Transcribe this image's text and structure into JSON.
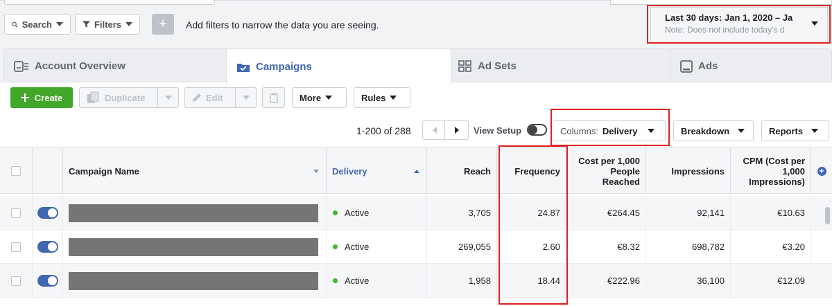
{
  "toolbar": {
    "search_label": "Search",
    "filters_label": "Filters",
    "add_filter_symbol": "+",
    "hint": "Add filters to narrow the data you are seeing."
  },
  "date_range": {
    "label": "Last 30 days: Jan 1, 2020 – Ja",
    "note": "Note: Does not include today's d"
  },
  "tabs": [
    {
      "label": "Account Overview",
      "icon": "account-overview-icon"
    },
    {
      "label": "Campaigns",
      "icon": "folder-check-icon"
    },
    {
      "label": "Ad Sets",
      "icon": "grid-icon"
    },
    {
      "label": "Ads",
      "icon": "ad-icon"
    }
  ],
  "actions": {
    "create_label": "Create",
    "duplicate_label": "Duplicate",
    "edit_label": "Edit",
    "more_label": "More",
    "rules_label": "Rules"
  },
  "pagination": {
    "range": "1-200 of 288",
    "view_setup_label": "View Setup"
  },
  "view_controls": {
    "columns_prefix": "Columns:",
    "columns_value": "Delivery",
    "breakdown_label": "Breakdown",
    "reports_label": "Reports"
  },
  "table": {
    "headers": {
      "campaign_name": "Campaign Name",
      "delivery": "Delivery",
      "reach": "Reach",
      "frequency": "Frequency",
      "cost_per_1000": "Cost per 1,000 People Reached",
      "impressions": "Impressions",
      "cpm": "CPM (Cost per 1,000 Impressions)"
    },
    "rows": [
      {
        "delivery": "Active",
        "reach": "3,705",
        "frequency": "24.87",
        "cost_per_1000": "€264.45",
        "impressions": "92,141",
        "cpm": "€10.63"
      },
      {
        "delivery": "Active",
        "reach": "269,055",
        "frequency": "2.60",
        "cost_per_1000": "€8.32",
        "impressions": "698,782",
        "cpm": "€3.20"
      },
      {
        "delivery": "Active",
        "reach": "1,958",
        "frequency": "18.44",
        "cost_per_1000": "€222.96",
        "impressions": "36,100",
        "cpm": "€12.09"
      }
    ]
  },
  "colors": {
    "accent": "#4267b2",
    "create_green": "#42a72a",
    "active_dot": "#42b72a",
    "highlight_red": "#e02020"
  }
}
